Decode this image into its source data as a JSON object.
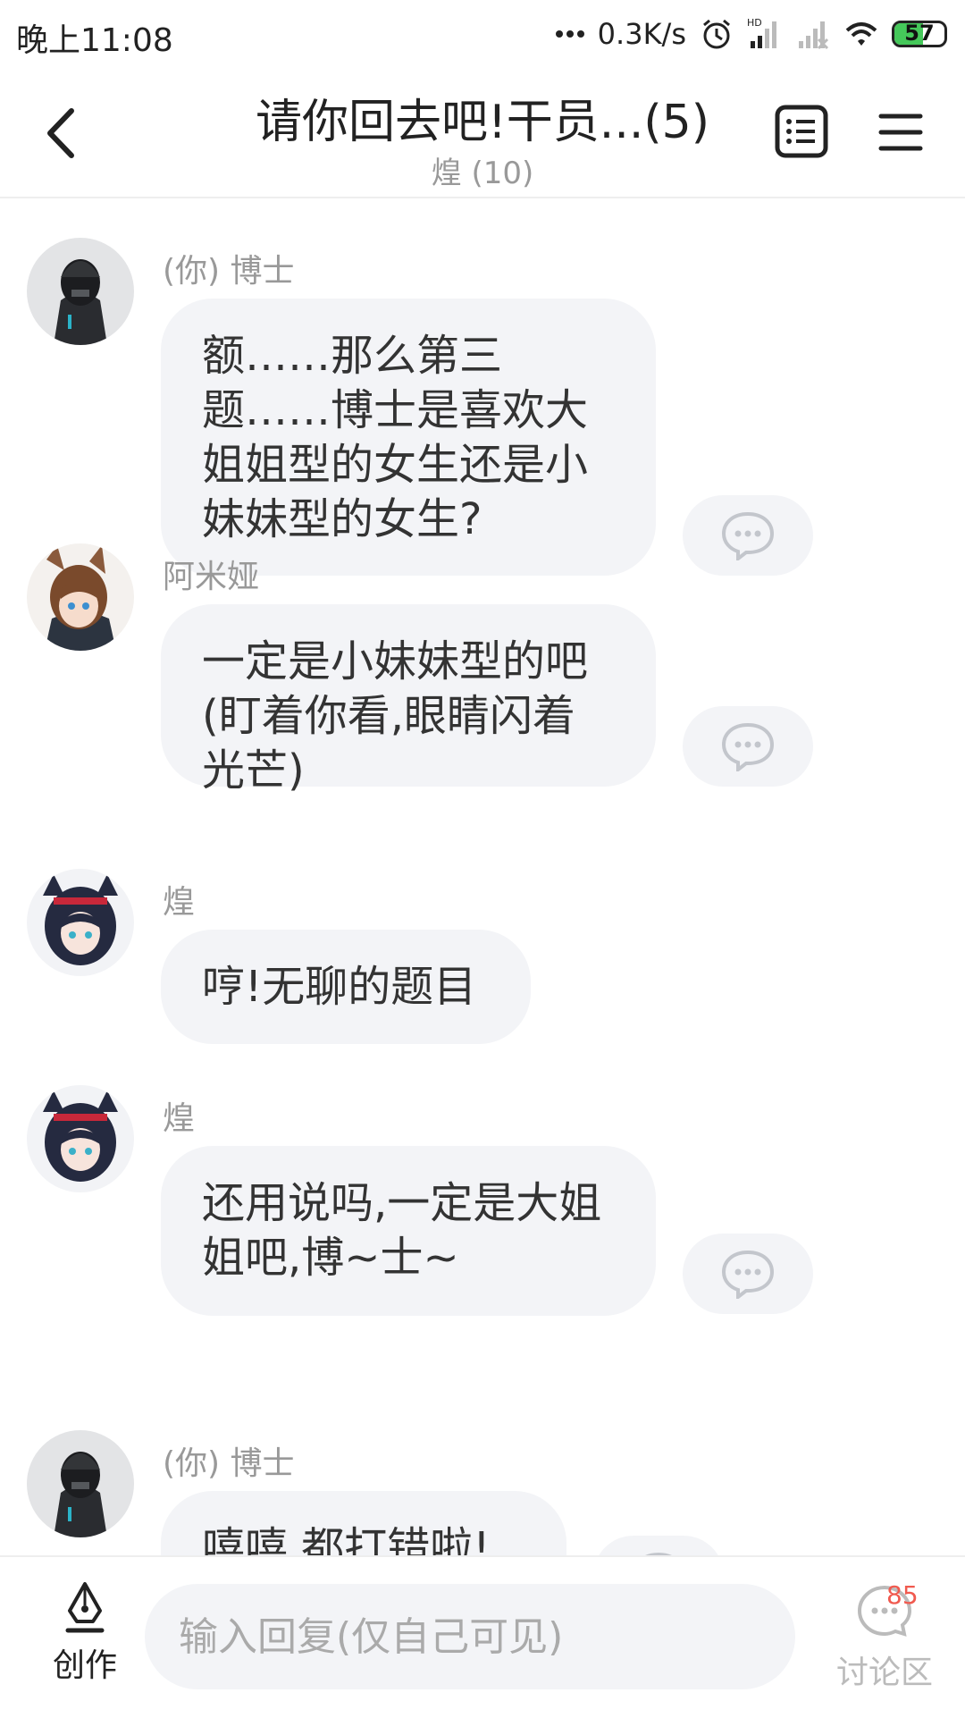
{
  "status": {
    "time": "晚上11:08",
    "net_speed": "0.3K/s",
    "battery": "57",
    "battery_level": 0.57,
    "icons": [
      "alarm-icon",
      "hd-signal-icon",
      "no-signal-icon",
      "wifi-icon",
      "battery-icon"
    ]
  },
  "header": {
    "title": "请你回去吧!干员...(5)",
    "subtitle": "煌 (10)"
  },
  "messages": [
    {
      "sender": "(你) 博士",
      "text": "额……那么第三题……博士是喜欢大姐姐型的女生还是小妹妹型的女生?",
      "avatar": "doctor",
      "has_comment": true
    },
    {
      "sender": "阿米娅",
      "text": "一定是小妹妹型的吧(盯着你看,眼睛闪着光芒)",
      "avatar": "amiya",
      "has_comment": true
    },
    {
      "sender": "煌",
      "text": "哼!无聊的题目",
      "avatar": "blaze",
      "has_comment": false
    },
    {
      "sender": "煌",
      "text": "还用说吗,一定是大姐姐吧,博~士~",
      "avatar": "blaze",
      "has_comment": true
    },
    {
      "sender": "(你) 博士",
      "text": "嘻嘻 都打错啦!",
      "avatar": "doctor",
      "has_comment": true
    }
  ],
  "bottom": {
    "create_label": "创作",
    "reply_placeholder": "输入回复(仅自己可见)",
    "discuss_label": "讨论区",
    "discuss_count": "85"
  },
  "colors": {
    "bubble": "#f3f4f7",
    "badge": "#f05a4f",
    "battery": "#45c85a"
  }
}
